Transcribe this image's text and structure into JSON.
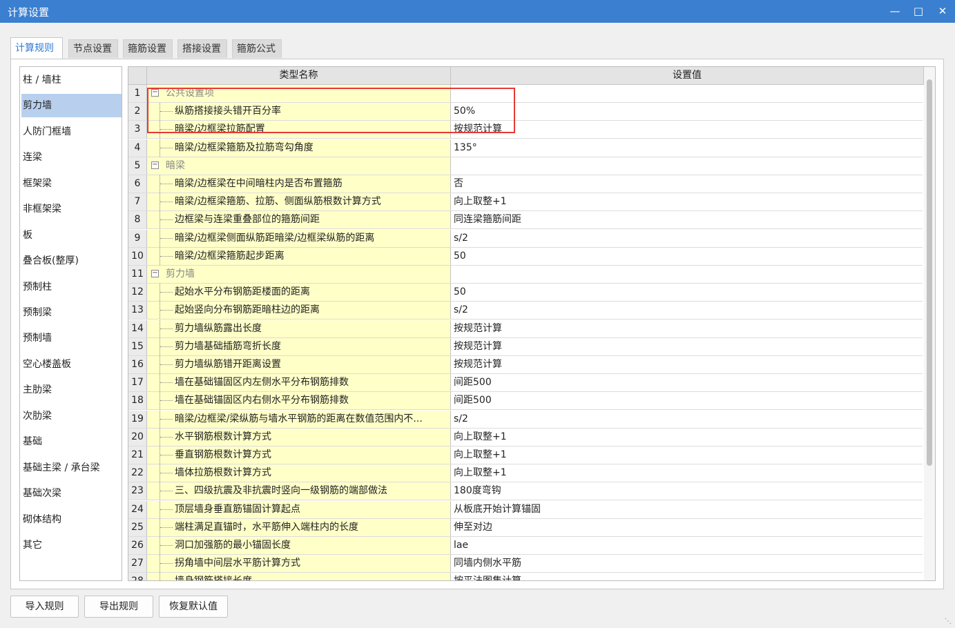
{
  "window": {
    "title": "计算设置",
    "minimize_icon": "minimize-icon",
    "maximize_icon": "maximize-icon",
    "close_icon": "close-icon"
  },
  "tabs": [
    {
      "label": "计算规则",
      "active": true
    },
    {
      "label": "节点设置",
      "active": false
    },
    {
      "label": "箍筋设置",
      "active": false
    },
    {
      "label": "搭接设置",
      "active": false
    },
    {
      "label": "箍筋公式",
      "active": false
    }
  ],
  "sidebar": {
    "selected": "剪力墙",
    "items": [
      "柱 / 墙柱",
      "剪力墙",
      "人防门框墙",
      "连梁",
      "框架梁",
      "非框架梁",
      "板",
      "叠合板(整厚)",
      "预制柱",
      "预制梁",
      "预制墙",
      "空心楼盖板",
      "主肋梁",
      "次肋梁",
      "基础",
      "基础主梁 / 承台梁",
      "基础次梁",
      "砌体结构",
      "其它"
    ]
  },
  "table": {
    "headers": {
      "name": "类型名称",
      "value": "设置值"
    },
    "rows": [
      {
        "num": "1",
        "name": "公共设置项",
        "value": "",
        "group": true
      },
      {
        "num": "2",
        "name": "纵筋搭接接头错开百分率",
        "value": "50%"
      },
      {
        "num": "3",
        "name": "暗梁/边框梁拉筋配置",
        "value": "按规范计算"
      },
      {
        "num": "4",
        "name": "暗梁/边框梁箍筋及拉筋弯勾角度",
        "value": "135°"
      },
      {
        "num": "5",
        "name": "暗梁",
        "value": "",
        "group": true
      },
      {
        "num": "6",
        "name": "暗梁/边框梁在中间暗柱内是否布置箍筋",
        "value": "否"
      },
      {
        "num": "7",
        "name": "暗梁/边框梁箍筋、拉筋、侧面纵筋根数计算方式",
        "value": "向上取整+1"
      },
      {
        "num": "8",
        "name": "边框梁与连梁重叠部位的箍筋间距",
        "value": "同连梁箍筋间距"
      },
      {
        "num": "9",
        "name": "暗梁/边框梁侧面纵筋距暗梁/边框梁纵筋的距离",
        "value": "s/2"
      },
      {
        "num": "10",
        "name": "暗梁/边框梁箍筋起步距离",
        "value": "50"
      },
      {
        "num": "11",
        "name": "剪力墙",
        "value": "",
        "group": true
      },
      {
        "num": "12",
        "name": "起始水平分布钢筋距楼面的距离",
        "value": "50"
      },
      {
        "num": "13",
        "name": "起始竖向分布钢筋距暗柱边的距离",
        "value": "s/2"
      },
      {
        "num": "14",
        "name": "剪力墙纵筋露出长度",
        "value": "按规范计算"
      },
      {
        "num": "15",
        "name": "剪力墙基础插筋弯折长度",
        "value": "按规范计算"
      },
      {
        "num": "16",
        "name": "剪力墙纵筋错开距离设置",
        "value": "按规范计算"
      },
      {
        "num": "17",
        "name": "墙在基础锚固区内左侧水平分布钢筋排数",
        "value": "间距500"
      },
      {
        "num": "18",
        "name": "墙在基础锚固区内右侧水平分布钢筋排数",
        "value": "间距500"
      },
      {
        "num": "19",
        "name": "暗梁/边框梁/梁纵筋与墙水平钢筋的距离在数值范围内不...",
        "value": "s/2"
      },
      {
        "num": "20",
        "name": "水平钢筋根数计算方式",
        "value": "向上取整+1"
      },
      {
        "num": "21",
        "name": "垂直钢筋根数计算方式",
        "value": "向上取整+1"
      },
      {
        "num": "22",
        "name": "墙体拉筋根数计算方式",
        "value": "向上取整+1"
      },
      {
        "num": "23",
        "name": "三、四级抗震及非抗震时竖向一级钢筋的端部做法",
        "value": "180度弯钩"
      },
      {
        "num": "24",
        "name": "顶层墙身垂直筋锚固计算起点",
        "value": "从板底开始计算锚固"
      },
      {
        "num": "25",
        "name": "端柱满足直锚时，水平筋伸入端柱内的长度",
        "value": "伸至对边"
      },
      {
        "num": "26",
        "name": "洞口加强筋的最小锚固长度",
        "value": "lae"
      },
      {
        "num": "27",
        "name": "拐角墙中间层水平筋计算方式",
        "value": "同墙内侧水平筋"
      },
      {
        "num": "28",
        "name": "墙身钢筋搭接长度",
        "value": "按平法图集计算"
      }
    ]
  },
  "buttons": {
    "import": "导入规则",
    "export": "导出规则",
    "restore": "恢复默认值"
  },
  "colors": {
    "titlebar": "#3a7fd0",
    "name_column_bg": "#ffffc8",
    "selected_item": "#b8d0ee",
    "highlight_box": "#e53935"
  }
}
